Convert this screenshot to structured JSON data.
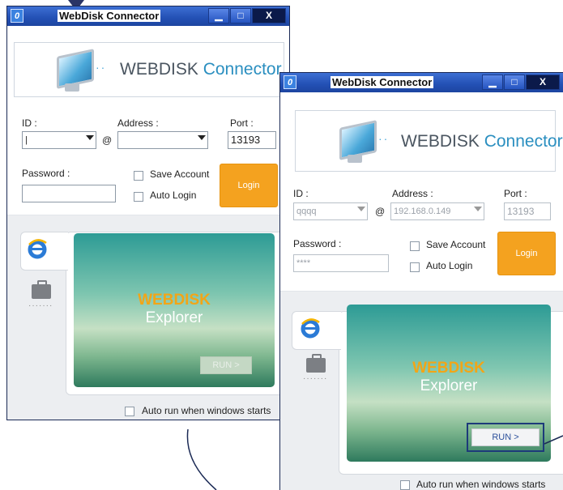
{
  "windows": [
    {
      "title": "WebDisk Connector",
      "app_icon": "0",
      "controls": {
        "minimize": "minimize-icon",
        "maximize": "maximize-icon",
        "close": "close-icon"
      },
      "logo": {
        "brand_main": "WEBDISK",
        "brand_sub": "Connector"
      },
      "labels": {
        "id": "ID :",
        "address": "Address :",
        "port": "Port :",
        "password": "Password :"
      },
      "fields": {
        "id_value": "|",
        "address_value": "",
        "port_value": "13193",
        "password_value": ""
      },
      "at_sign": "@",
      "checkboxes": {
        "save_account": "Save Account",
        "auto_login": "Auto Login",
        "auto_run": "Auto run when windows starts"
      },
      "login_label": "Login",
      "explorer": {
        "title": "WEBDISK",
        "subtitle": "Explorer",
        "run_label": "RUN >"
      }
    },
    {
      "title": "WebDisk Connector",
      "app_icon": "0",
      "controls": {
        "minimize": "minimize-icon",
        "maximize": "maximize-icon",
        "close": "close-icon"
      },
      "logo": {
        "brand_main": "WEBDISK",
        "brand_sub": "Connector"
      },
      "labels": {
        "id": "ID :",
        "address": "Address :",
        "port": "Port :",
        "password": "Password :"
      },
      "fields": {
        "id_value": "qqqq",
        "address_value": "192.168.0.149",
        "port_value": "13193",
        "password_value": "****"
      },
      "at_sign": "@",
      "checkboxes": {
        "save_account": "Save Account",
        "auto_login": "Auto Login",
        "auto_run": "Auto run when windows starts"
      },
      "login_label": "Login",
      "explorer": {
        "title": "WEBDISK",
        "subtitle": "Explorer",
        "run_label": "RUN >"
      }
    }
  ],
  "colors": {
    "accent_orange": "#f4a21f",
    "titlebar_blue": "#2350b4",
    "brand_blue": "#2b8fc0",
    "explorer_teal": "#2d9b95"
  }
}
